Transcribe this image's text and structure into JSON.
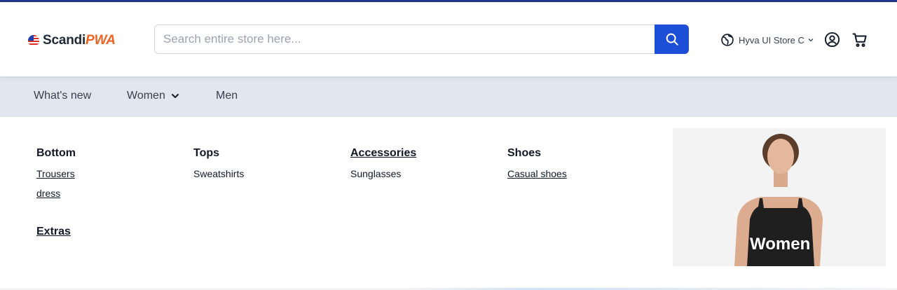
{
  "brand": {
    "name_part1": "Scandi",
    "name_part2": "PWA"
  },
  "search": {
    "placeholder": "Search entire store here..."
  },
  "store_switcher": {
    "label": "Hyva UI Store C"
  },
  "nav": {
    "items": [
      {
        "label": "What's new"
      },
      {
        "label": "Women"
      },
      {
        "label": "Men"
      }
    ]
  },
  "mega_menu": {
    "columns": [
      {
        "title": "Bottom",
        "links": [
          "Trousers",
          "dress"
        ]
      },
      {
        "title": "Tops",
        "links": [
          "Sweatshirts"
        ]
      },
      {
        "title": "Accessories",
        "links": [
          "Sunglasses"
        ]
      },
      {
        "title": "Shoes",
        "links": [
          "Casual shoes"
        ]
      }
    ],
    "extras": "Extras",
    "promo_label": "Women"
  },
  "colors": {
    "accent": "#1d4ed8",
    "topline": "#1e3a8a",
    "nav_bg": "#e1e7ef",
    "brand_orange": "#f26323"
  },
  "icons": [
    "flag-icon",
    "search-icon",
    "globe-icon",
    "chevron-down-icon",
    "account-icon",
    "cart-icon"
  ]
}
